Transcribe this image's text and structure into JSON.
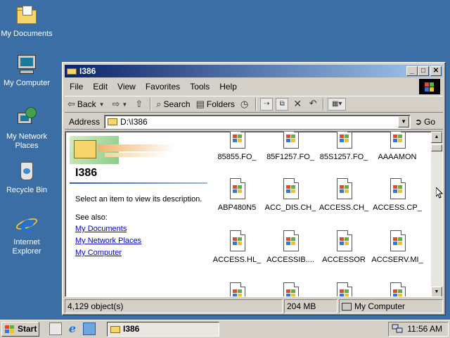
{
  "desktop": {
    "icons": [
      {
        "label": "My Documents",
        "icon": "my-documents-icon"
      },
      {
        "label": "My Computer",
        "icon": "my-computer-icon"
      },
      {
        "label": "My Network Places",
        "icon": "network-places-icon"
      },
      {
        "label": "Recycle Bin",
        "icon": "recycle-bin-icon"
      },
      {
        "label": "Internet Explorer",
        "icon": "internet-explorer-icon"
      }
    ]
  },
  "window": {
    "title": "I386",
    "menu": [
      "File",
      "Edit",
      "View",
      "Favorites",
      "Tools",
      "Help"
    ],
    "toolbar": {
      "back": "Back",
      "search": "Search",
      "folders": "Folders"
    },
    "address": {
      "label": "Address",
      "value": "D:\\I386",
      "go": "Go"
    },
    "left_pane": {
      "title": "I386",
      "description": "Select an item to view its description.",
      "see_also": "See also:",
      "links": [
        "My Documents",
        "My Network Places",
        "My Computer"
      ]
    },
    "files": [
      "85855.FO_",
      "85F1257.FO_",
      "85S1257.FO_",
      "AAAAMON",
      "ABP480N5",
      "ACC_DIS.CH_",
      "ACCESS.CH_",
      "ACCESS.CP_",
      "ACCESS.HL_",
      "ACCESSIB....",
      "ACCESSOR",
      "ACCSERV.MI_",
      "",
      "",
      "",
      ""
    ],
    "status": {
      "objects": "4,129 object(s)",
      "size": "204 MB",
      "zone": "My Computer"
    }
  },
  "taskbar": {
    "start": "Start",
    "active_task": "I386",
    "clock": "11:56 AM"
  },
  "colors": {
    "desktop": "#3a6ea5",
    "title_start": "#0a246a",
    "title_end": "#a6caf0",
    "face": "#d4d0c8",
    "link": "#0000cc"
  }
}
